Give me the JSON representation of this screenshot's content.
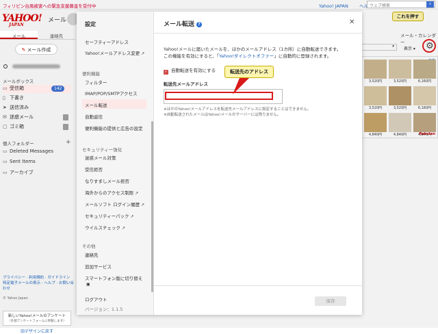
{
  "topbar": {
    "promo": "フィリピン台風被害への緊急支援募金を受付中",
    "link_japan": "Yahoo! JAPAN",
    "link_help": "ヘルプ",
    "search_placeholder": "ウェブ検索"
  },
  "left": {
    "logo": "YAHOO!",
    "logo_sub": "JAPAN",
    "logo_mail": "メール",
    "tabs": [
      "メール",
      "連絡先"
    ],
    "compose": "メール作成",
    "mailbox_title": "メールボックス",
    "folders": [
      {
        "label": "受信箱",
        "icon": "inbox-icon",
        "glyph": "▭",
        "count": "142"
      },
      {
        "label": "下書き",
        "icon": "draft-icon",
        "glyph": "▯"
      },
      {
        "label": "送信済み",
        "icon": "send-icon",
        "glyph": "➤"
      },
      {
        "label": "迷惑メール",
        "icon": "spam-icon",
        "glyph": "✉"
      },
      {
        "label": "ゴミ箱",
        "icon": "trash-icon",
        "glyph": "▢"
      }
    ],
    "personal_title": "個人フォルダー",
    "personal": [
      {
        "label": "Deleted Messages"
      },
      {
        "label": "Sent Items"
      },
      {
        "label": "アーカイブ"
      }
    ],
    "footer_links_1": "プライバシー · 利用規約 · ガイドライン",
    "footer_links_2": "特定電子メールの表示 · ヘルプ · お問い合わせ",
    "copyright": "© Yahoo Japan",
    "survey": "新しいYahoo!メールのアンケート",
    "survey_sub": "（外部アンケートフォームに移動します）",
    "redesign": "旧デザインに戻す"
  },
  "right": {
    "label": "メール・カレンダー",
    "display": "表示",
    "tip": "これを押す",
    "ad_tag": "広告",
    "ad_prices": [
      "3,520円",
      "3,520円",
      "6,160円",
      "3,520円",
      "3,520円",
      "6,160円",
      "4,840円",
      "4,840円",
      "4,840円"
    ],
    "rakuten": "Rakuten"
  },
  "dialog": {
    "nav_title": "設定",
    "nav_items_top": [
      {
        "label": "セーフティーアドレス",
        "ext": false
      },
      {
        "label": "Yahoo!メールアドレス変更",
        "ext": true
      }
    ],
    "group_convenience": "便利機能",
    "nav_convenience": [
      {
        "label": "フィルター",
        "ext": false,
        "active": false
      },
      {
        "label": "IMAP/POP/SMTPアクセス",
        "ext": false,
        "active": false
      },
      {
        "label": "メール転送",
        "ext": false,
        "active": true
      },
      {
        "label": "自動返信",
        "ext": false,
        "active": false
      },
      {
        "label": "便利機能の提供と広告の設定",
        "ext": false,
        "active": false
      }
    ],
    "group_security": "セキュリティー強化",
    "nav_security": [
      {
        "label": "迷惑メール対策",
        "ext": false
      },
      {
        "label": "受信拒否",
        "ext": false
      },
      {
        "label": "なりすましメール拒否",
        "ext": false
      },
      {
        "label": "海外からのアクセス制限",
        "ext": true
      },
      {
        "label": "メールソフト ログイン履歴",
        "ext": true
      },
      {
        "label": "セキュリティーパック",
        "ext": true
      },
      {
        "label": "ウイルスチェック",
        "ext": true
      }
    ],
    "group_other": "その他",
    "nav_other": [
      {
        "label": "連絡先",
        "ext": false
      },
      {
        "label": "追加サービス",
        "ext": false
      },
      {
        "label": "スマートフォン版に切り替え",
        "ext": false
      }
    ],
    "logout": "ログアウト",
    "version": "バージョン：1.1.5",
    "title": "メール転送",
    "desc_1": "Yahoo!メールに届いたメールを、ほかのメールアドレス（1カ所）に自動転送できます。",
    "desc_2a": "この機能を有効にすると、「",
    "desc_2_link": "Yahoo!ダイレクトオファー",
    "desc_2b": "」に自動的に登録されます。",
    "checkbox_label": "自動転送を有効にする",
    "field_label": "転送先メールアドレス",
    "field_value": "",
    "note_1": "※ほかのYahoo!メールアドレスを転送先メールアドレスに設定することはできません。",
    "note_2": "※自動転送されたメールはYahoo!メールのサーバーには残りません。",
    "save": "保存",
    "callout": "転送先のアドレス"
  },
  "colors": {
    "accent": "#cc0000",
    "link": "#1a5fb4",
    "badge": "#3b6ec7",
    "annotation_red": "#d91a1a",
    "callout_bg": "#fdf5b0"
  }
}
